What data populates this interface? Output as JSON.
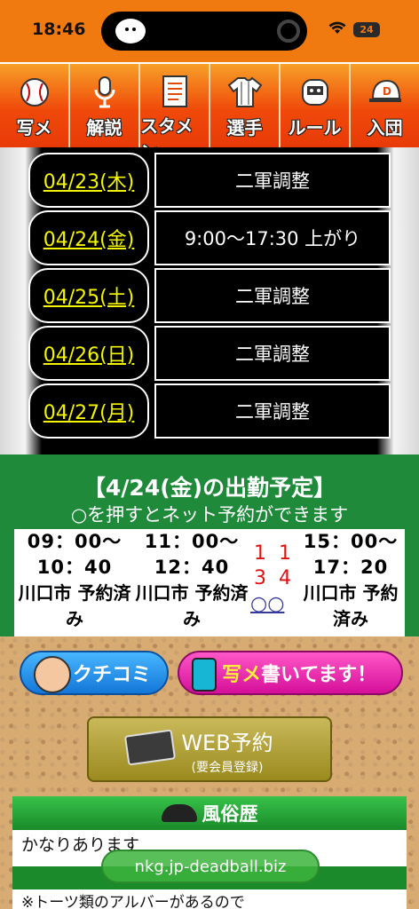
{
  "status_bar": {
    "time": "18:46",
    "battery": "24"
  },
  "nav": {
    "items": [
      {
        "label": "写メ",
        "icon": "baseball-icon"
      },
      {
        "label": "解説",
        "icon": "microphone-icon"
      },
      {
        "label": "スタメン",
        "icon": "lineup-sheet-icon"
      },
      {
        "label": "選手",
        "icon": "jersey-icon"
      },
      {
        "label": "ルール",
        "icon": "catcher-mask-icon"
      },
      {
        "label": "入団",
        "icon": "cap-icon"
      }
    ]
  },
  "schedule": {
    "rows": [
      {
        "date": "04/23(木)",
        "status": "二軍調整"
      },
      {
        "date": "04/24(金)",
        "status": "9:00～17:30 上がり"
      },
      {
        "date": "04/25(土)",
        "status": "二軍調整"
      },
      {
        "date": "04/26(日)",
        "status": "二軍調整"
      },
      {
        "date": "04/27(月)",
        "status": "二軍調整"
      }
    ]
  },
  "attendance": {
    "title": "【4/24(金)の出勤予定】",
    "subtitle": "○を押すとネット予約ができます",
    "slots": [
      {
        "start": "09：00～",
        "end": "10：40",
        "location": "川口市 予約済み"
      },
      {
        "start": "11：00～",
        "end": "12：40",
        "location": "川口市 予約済み"
      },
      {
        "start": "15：00～",
        "end": "17：20",
        "location": "川口市 予約済み"
      }
    ],
    "middle_digits": "11 34",
    "middle_circles": "○○"
  },
  "buttons": {
    "kuchikomi": "クチコミ",
    "shame_highlight": "写メ",
    "shame_rest": "書いてます！",
    "web_reserve": "WEB予約",
    "web_reserve_note": "(要会員登録)"
  },
  "fuzoku": {
    "title": "風俗歴",
    "body": "かなりあります",
    "note": "※トーツ類のアルバーがあるので"
  },
  "url_pill": "nkg.jp-deadball.biz"
}
